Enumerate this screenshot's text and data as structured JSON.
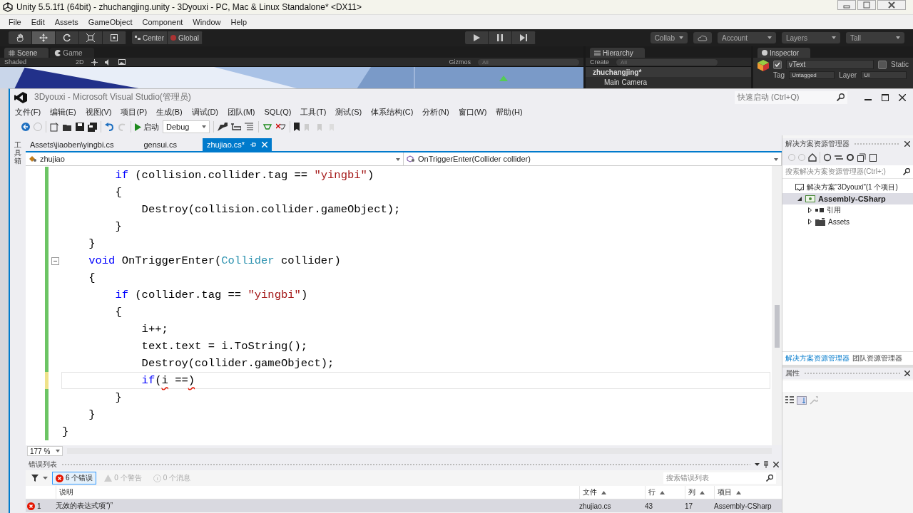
{
  "unity": {
    "title": "Unity 5.5.1f1 (64bit) - zhuchangjing.unity - 3Dyouxi - PC, Mac & Linux Standalone* <DX11>",
    "menu": [
      "File",
      "Edit",
      "Assets",
      "GameObject",
      "Component",
      "Window",
      "Help"
    ],
    "tools": [
      {
        "kind": "hand",
        "selected": false
      },
      {
        "kind": "move",
        "selected": true
      },
      {
        "kind": "rotate",
        "selected": false
      },
      {
        "kind": "scale",
        "selected": false
      },
      {
        "kind": "rect",
        "selected": false
      }
    ],
    "pivot": [
      "Center",
      "Global"
    ],
    "right_buttons": [
      {
        "kind": "collab",
        "label": "Collab"
      },
      {
        "kind": "cloud"
      },
      {
        "kind": "dropdown",
        "label": "Account"
      },
      {
        "kind": "dropdown",
        "label": "Layers"
      },
      {
        "kind": "dropdown",
        "label": "Tall"
      }
    ],
    "scene": {
      "tabs": [
        {
          "label": "Scene",
          "selected": true
        },
        {
          "label": "Game",
          "selected": false
        }
      ],
      "shading": "Shaded",
      "mode": "2D",
      "gizmos": "Gizmos",
      "search_placeholder": "All"
    },
    "hierarchy": {
      "title": "Hierarchy",
      "create": "Create",
      "search_placeholder": "All",
      "scene": "zhuchangjing*",
      "items": [
        "Main Camera"
      ]
    },
    "inspector": {
      "title": "Inspector",
      "active": true,
      "name": "vText",
      "static": false,
      "static_label": "Static",
      "tag_label": "Tag",
      "tag": "Untagged",
      "layer_label": "Layer",
      "layer": "UI"
    }
  },
  "vs": {
    "title": "3Dyouxi - Microsoft Visual Studio(管理员)",
    "quick_launch_placeholder": "快速启动 (Ctrl+Q)",
    "menu": [
      "文件(F)",
      "编辑(E)",
      "视图(V)",
      "项目(P)",
      "生成(B)",
      "调试(D)",
      "团队(M)",
      "SQL(Q)",
      "工具(T)",
      "测试(S)",
      "体系结构(C)",
      "分析(N)",
      "窗口(W)",
      "帮助(H)"
    ],
    "toolbar": {
      "start": "启动",
      "config": "Debug"
    },
    "toolbox": "工具箱",
    "tabs": [
      {
        "label": "Assets\\jiaoben\\yingbi.cs",
        "selected": false
      },
      {
        "label": "gensui.cs",
        "selected": false
      },
      {
        "label": "zhujiao.cs*",
        "selected": true
      }
    ],
    "nav": {
      "type": "zhujiao",
      "member": "OnTriggerEnter(Collider collider)"
    },
    "code": [
      {
        "unsaved": false,
        "current": false,
        "tokens": [
          {
            "kind": "keyword",
            "text": "        if"
          },
          {
            "kind": "plain",
            "text": " (collision.collider.tag == "
          },
          {
            "kind": "string",
            "text": "\"yingbi\""
          },
          {
            "kind": "plain",
            "text": ")"
          }
        ]
      },
      {
        "unsaved": false,
        "current": false,
        "tokens": [
          {
            "kind": "plain",
            "text": "        {"
          }
        ]
      },
      {
        "unsaved": false,
        "current": false,
        "tokens": [
          {
            "kind": "plain",
            "text": "            Destroy(collision.collider.gameObject);"
          }
        ]
      },
      {
        "unsaved": false,
        "current": false,
        "tokens": [
          {
            "kind": "plain",
            "text": "        }"
          }
        ]
      },
      {
        "unsaved": false,
        "current": false,
        "tokens": [
          {
            "kind": "plain",
            "text": "    }"
          }
        ]
      },
      {
        "unsaved": false,
        "current": false,
        "collapsible": true,
        "tokens": [
          {
            "kind": "keyword",
            "text": "    void"
          },
          {
            "kind": "plain",
            "text": " OnTriggerEnter("
          },
          {
            "kind": "type",
            "text": "Collider"
          },
          {
            "kind": "plain",
            "text": " collider)"
          }
        ]
      },
      {
        "unsaved": false,
        "current": false,
        "tokens": [
          {
            "kind": "plain",
            "text": "    {"
          }
        ]
      },
      {
        "unsaved": false,
        "current": false,
        "tokens": [
          {
            "kind": "keyword",
            "text": "        if"
          },
          {
            "kind": "plain",
            "text": " (collider.tag == "
          },
          {
            "kind": "string",
            "text": "\"yingbi\""
          },
          {
            "kind": "plain",
            "text": ")"
          }
        ]
      },
      {
        "unsaved": false,
        "current": false,
        "tokens": [
          {
            "kind": "plain",
            "text": "        {"
          }
        ]
      },
      {
        "unsaved": false,
        "current": false,
        "tokens": [
          {
            "kind": "plain",
            "text": "            i++;"
          }
        ]
      },
      {
        "unsaved": false,
        "current": false,
        "tokens": [
          {
            "kind": "plain",
            "text": "            text.text = i.ToString();"
          }
        ]
      },
      {
        "unsaved": false,
        "current": false,
        "tokens": [
          {
            "kind": "plain",
            "text": "            Destroy(collider.gameObject);"
          }
        ]
      },
      {
        "unsaved": true,
        "current": true,
        "tokens": [
          {
            "kind": "keyword",
            "text": "            if"
          },
          {
            "kind": "plain",
            "text": "("
          },
          {
            "kind": "error",
            "text": "i"
          },
          {
            "kind": "plain",
            "text": " =="
          },
          {
            "kind": "error",
            "text": ")"
          }
        ]
      },
      {
        "unsaved": false,
        "current": false,
        "tokens": [
          {
            "kind": "plain",
            "text": "        }"
          }
        ]
      },
      {
        "unsaved": false,
        "current": false,
        "tokens": [
          {
            "kind": "plain",
            "text": "    }"
          }
        ]
      },
      {
        "unsaved": false,
        "current": false,
        "tokens": [
          {
            "kind": "plain",
            "text": "}"
          }
        ]
      }
    ],
    "zoom": "177 %",
    "errors": {
      "title": "错误列表",
      "filters": [
        {
          "kind": "error",
          "label": "6 个错误",
          "selected": true
        },
        {
          "kind": "warning",
          "label": "0 个警告",
          "selected": false
        },
        {
          "kind": "message",
          "label": "0 个消息",
          "selected": false
        }
      ],
      "search_placeholder": "搜索错误列表",
      "columns": [
        {
          "label": "说明",
          "sortable": false
        },
        {
          "label": "文件",
          "sortable": true
        },
        {
          "label": "行",
          "sortable": true
        },
        {
          "label": "列",
          "sortable": true
        },
        {
          "label": "项目",
          "sortable": true
        }
      ],
      "rows": [
        {
          "number": "1",
          "description": "无效的表达式项“)”",
          "file": "zhujiao.cs",
          "line": "43",
          "column": "17",
          "project": "Assembly-CSharp",
          "selected": true
        }
      ]
    },
    "solution": {
      "title": "解决方案资源管理器",
      "search_placeholder": "搜索解决方案资源管理器(Ctrl+;)",
      "tree": [
        {
          "kind": "solution",
          "label": "解决方案“3Dyouxi”(1 个项目)",
          "selected": false,
          "children": [
            {
              "kind": "project",
              "label": "Assembly-CSharp",
              "selected": true,
              "expanded": true,
              "children": [
                {
                  "kind": "references",
                  "label": "引用",
                  "selected": false,
                  "expanded": false
                },
                {
                  "kind": "folder",
                  "label": "Assets",
                  "selected": false,
                  "expanded": false
                }
              ]
            }
          ]
        }
      ],
      "tabs": [
        {
          "label": "解决方案资源管理器",
          "selected": true
        },
        {
          "label": "团队资源管理器",
          "selected": false
        }
      ]
    },
    "properties": {
      "title": "属性"
    }
  }
}
